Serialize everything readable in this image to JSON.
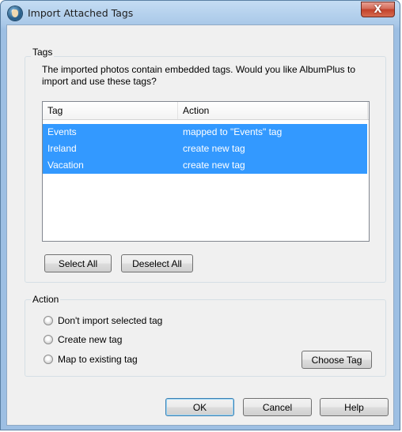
{
  "window": {
    "title": "Import Attached Tags",
    "close_glyph": "X"
  },
  "tags_group": {
    "label": "Tags",
    "description": "The imported photos contain embedded tags. Would you like AlbumPlus to import and use these tags?",
    "columns": [
      "Tag",
      "Action"
    ],
    "rows": [
      {
        "tag": "Events",
        "action": "mapped to \"Events\" tag"
      },
      {
        "tag": "Ireland",
        "action": "create new tag"
      },
      {
        "tag": "Vacation",
        "action": "create new tag"
      }
    ],
    "select_all_label": "Select All",
    "deselect_all_label": "Deselect All"
  },
  "action_group": {
    "label": "Action",
    "options": [
      "Don't import selected tag",
      "Create new tag",
      "Map to existing tag"
    ],
    "choose_tag_label": "Choose Tag"
  },
  "footer": {
    "ok_label": "OK",
    "cancel_label": "Cancel",
    "help_label": "Help"
  },
  "colors": {
    "selection": "#3399ff",
    "title_glass": "#a9c8e8",
    "close_red": "#c2412a"
  }
}
